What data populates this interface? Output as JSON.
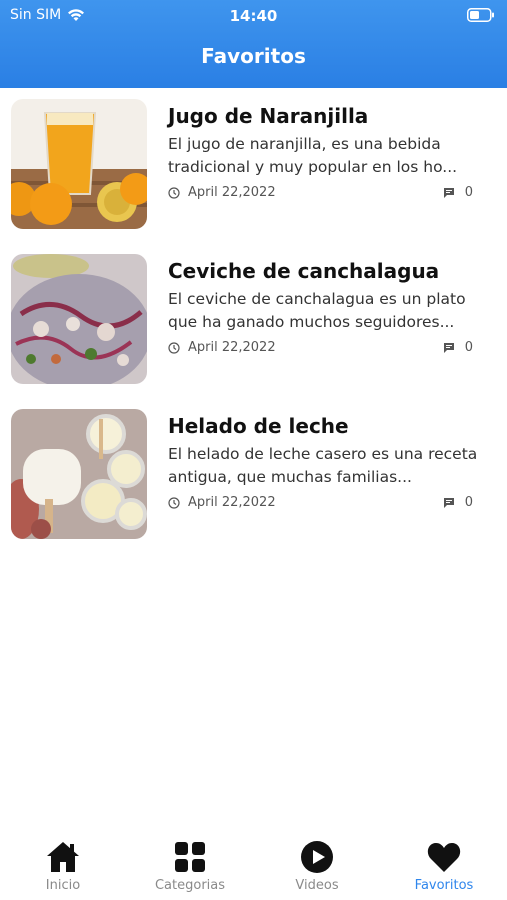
{
  "status_bar": {
    "carrier": "Sin SIM",
    "time": "14:40"
  },
  "header": {
    "title": "Favoritos"
  },
  "items": [
    {
      "title": "Jugo de Naranjilla",
      "description": "El jugo de naranjilla, es una bebida tradicional y muy popular en los ho...",
      "date": "April 22,2022",
      "comments": "0",
      "image": "orange-juice-photo"
    },
    {
      "title": "Ceviche de canchalagua",
      "description": "El ceviche de canchalagua es un plato que ha ganado muchos seguidores...",
      "date": "April 22,2022",
      "comments": "0",
      "image": "ceviche-photo"
    },
    {
      "title": "Helado de leche",
      "description": "El helado de leche casero es una receta antigua, que muchas familias...",
      "date": "April 22,2022",
      "comments": "0",
      "image": "ice-cream-photo"
    }
  ],
  "tabs": [
    {
      "label": "Inicio",
      "icon": "home-icon"
    },
    {
      "label": "Categorias",
      "icon": "grid-icon"
    },
    {
      "label": "Videos",
      "icon": "play-icon"
    },
    {
      "label": "Favoritos",
      "icon": "heart-icon",
      "active": true
    }
  ],
  "colors": {
    "accent": "#2f86ec",
    "header_bg": "#3388ea"
  }
}
